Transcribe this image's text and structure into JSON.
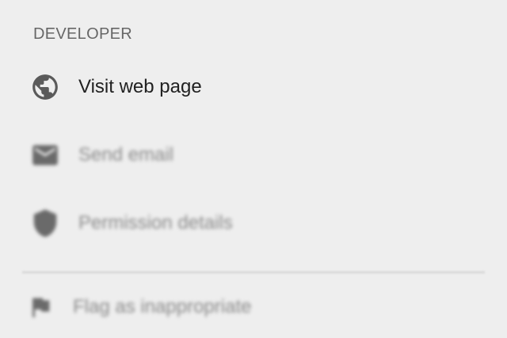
{
  "section": {
    "title": "DEVELOPER"
  },
  "items": [
    {
      "label": "Visit web page",
      "icon": "globe-icon"
    },
    {
      "label": "Send email",
      "icon": "email-icon"
    },
    {
      "label": "Permission details",
      "icon": "shield-icon"
    }
  ],
  "footer_item": {
    "label": "Flag as inappropriate",
    "icon": "flag-icon"
  },
  "colors": {
    "background": "#eeeeee",
    "primary_text": "#212121",
    "section_header": "#666666",
    "divider": "#cfcfcf"
  }
}
